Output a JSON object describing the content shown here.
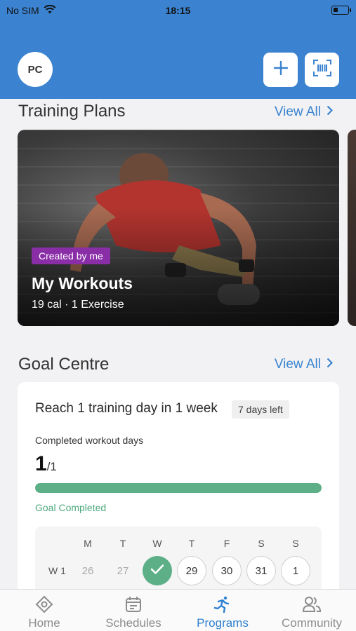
{
  "status_bar": {
    "carrier": "No SIM",
    "time": "18:15"
  },
  "header": {
    "avatar_initials": "PC",
    "add_icon": "plus-icon",
    "scan_icon": "barcode-scan-icon",
    "color": "#3b83d0"
  },
  "training_plans": {
    "title": "Training Plans",
    "view_all": "View All",
    "card": {
      "badge": "Created by me",
      "title": "My Workouts",
      "meta": "19 cal · 1 Exercise"
    }
  },
  "goal_centre": {
    "title": "Goal Centre",
    "view_all": "View All",
    "goal": {
      "title": "Reach 1 training day in 1 week",
      "days_left": "7 days left",
      "completed_label": "Completed workout days",
      "completed": "1",
      "total": "/1",
      "progress_fraction": 1.0,
      "status": "Goal Completed"
    },
    "week": {
      "label": "W 1",
      "days": [
        "M",
        "T",
        "W",
        "T",
        "F",
        "S",
        "S"
      ],
      "dates": [
        "26",
        "27",
        "",
        "29",
        "30",
        "31",
        "1"
      ],
      "states": [
        "past",
        "past",
        "done",
        "upcoming",
        "upcoming",
        "upcoming",
        "upcoming"
      ]
    }
  },
  "tabbar": {
    "tabs": [
      {
        "label": "Home",
        "icon": "home-icon"
      },
      {
        "label": "Schedules",
        "icon": "calendar-icon"
      },
      {
        "label": "Programs",
        "icon": "running-person-icon"
      },
      {
        "label": "Community",
        "icon": "people-icon"
      }
    ],
    "active_index": 2
  },
  "colors": {
    "accent": "#3a84cf",
    "success": "#5caf86",
    "badge": "#8a2ea8"
  }
}
